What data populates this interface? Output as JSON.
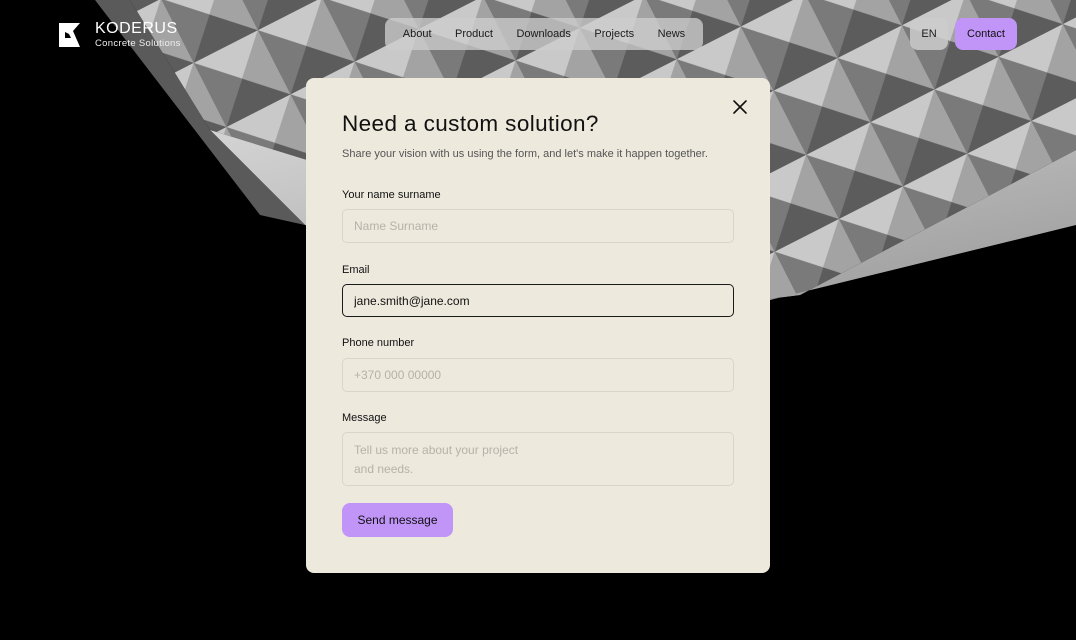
{
  "brand": {
    "name": "KODERUS",
    "tagline": "Concrete Solutions"
  },
  "nav": {
    "items": [
      "About",
      "Product",
      "Downloads",
      "Projects",
      "News"
    ]
  },
  "language": "EN",
  "contact_label": "Contact",
  "modal": {
    "title": "Need a custom solution?",
    "subtitle": "Share your vision with us using the form, and let's make it happen together.",
    "name": {
      "label": "Your name surname",
      "placeholder": "Name Surname",
      "value": ""
    },
    "email": {
      "label": "Email",
      "placeholder": "",
      "value": "jane.smith@jane.com"
    },
    "phone": {
      "label": "Phone number",
      "placeholder": "+370 000 00000",
      "value": ""
    },
    "message": {
      "label": "Message",
      "placeholder": "Tell us more about your project\nand needs.",
      "value": ""
    },
    "submit_label": "Send message"
  }
}
